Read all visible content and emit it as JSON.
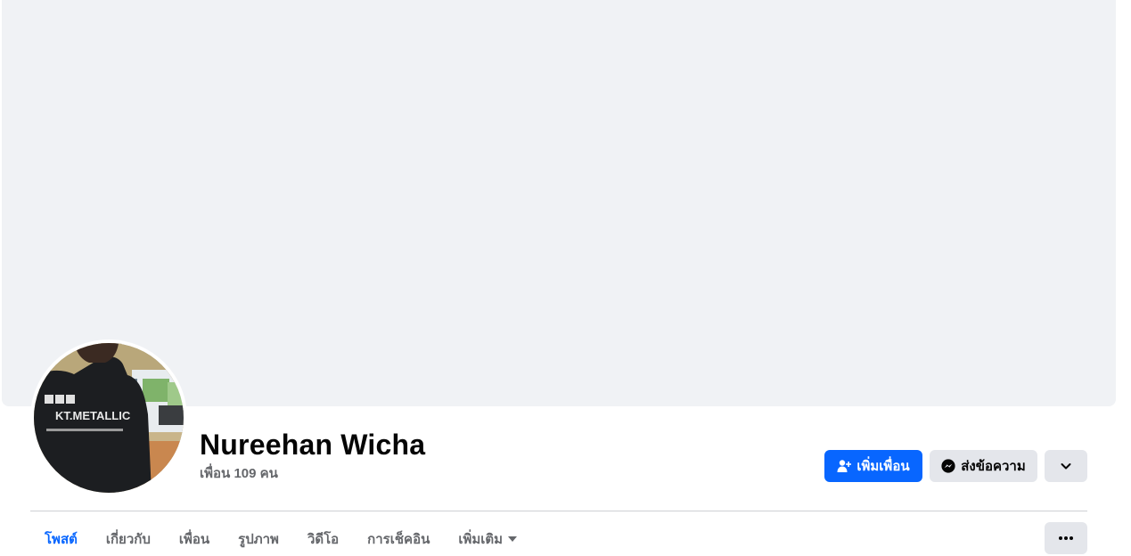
{
  "profile": {
    "name": "Nureehan Wicha",
    "friends_count": "เพื่อน 109 คน",
    "avatar_shirt_text": "KT.METALLIC"
  },
  "actions": {
    "add_friend_label": "เพิ่มเพื่อน",
    "message_label": "ส่งข้อความ"
  },
  "tabs": [
    {
      "label": "โพสต์",
      "active": true
    },
    {
      "label": "เกี่ยวกับ",
      "active": false
    },
    {
      "label": "เพื่อน",
      "active": false
    },
    {
      "label": "รูปภาพ",
      "active": false
    },
    {
      "label": "วิดีโอ",
      "active": false
    },
    {
      "label": "การเช็คอิน",
      "active": false
    },
    {
      "label": "เพิ่มเติม",
      "active": false
    }
  ],
  "icons": {
    "add_friend": "person-plus-icon",
    "message": "messenger-icon",
    "more": "chevron-down-icon",
    "tabs_more": "ellipsis-icon"
  },
  "colors": {
    "accent": "#0866ff",
    "cover": "#f0f2f5",
    "secondary_button": "#e4e6eb",
    "muted_text": "#65676b"
  }
}
